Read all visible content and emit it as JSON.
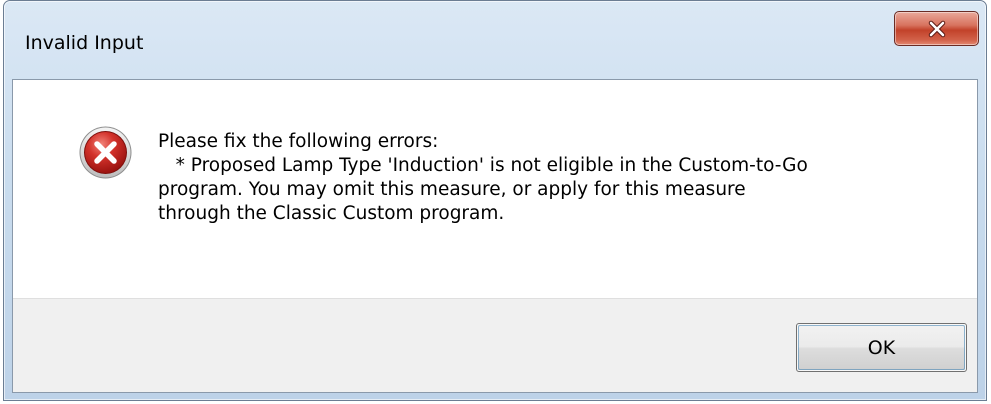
{
  "window": {
    "title": "Invalid Input",
    "close_icon": "close-icon"
  },
  "dialog": {
    "icon": "error-icon",
    "message_lines": [
      "Please fix the following errors:",
      "   * Proposed Lamp Type 'Induction' is not eligible in the Custom-to-Go",
      "program. You may omit this measure, or apply for this measure",
      "through the Classic Custom program."
    ],
    "ok_label": "OK"
  },
  "colors": {
    "error_red": "#d3322b",
    "close_button_red": "#c2422a",
    "title_bar": "#c9dcee",
    "footer": "#f0f0f0"
  }
}
